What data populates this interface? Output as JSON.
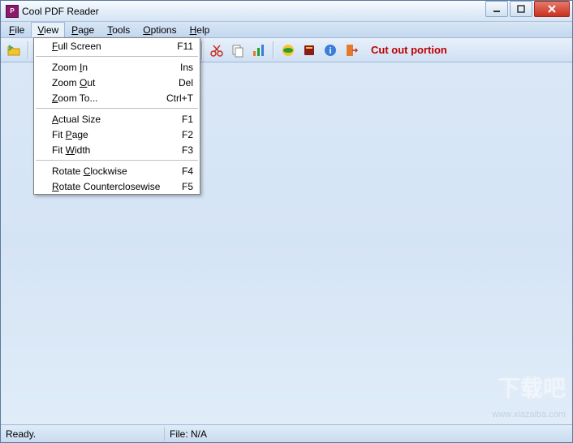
{
  "window": {
    "title": "Cool PDF Reader"
  },
  "menubar": {
    "file": "File",
    "view": "View",
    "page": "Page",
    "tools": "Tools",
    "options": "Options",
    "help": "Help"
  },
  "view_menu": {
    "full_screen": {
      "label": "F",
      "rest": "ull Screen",
      "shortcut": "F11"
    },
    "zoom_in": {
      "label": "Zoom ",
      "u": "I",
      "rest": "n",
      "shortcut": "Ins"
    },
    "zoom_out": {
      "label": "Zoom ",
      "u": "O",
      "rest": "ut",
      "shortcut": "Del"
    },
    "zoom_to": {
      "label": "Z",
      "rest": "oom To...",
      "shortcut": "Ctrl+T"
    },
    "actual_size": {
      "label": "A",
      "rest": "ctual Size",
      "shortcut": "F1"
    },
    "fit_page": {
      "label": "Fit ",
      "u": "P",
      "rest": "age",
      "shortcut": "F2"
    },
    "fit_width": {
      "label": "Fit ",
      "u": "W",
      "rest": "idth",
      "shortcut": "F3"
    },
    "rotate_cw": {
      "label": "Rotate ",
      "u": "C",
      "rest": "lockwise",
      "shortcut": "F4"
    },
    "rotate_ccw": {
      "label": "R",
      "rest": "otate Counterclosewise",
      "shortcut": "F5"
    }
  },
  "toolbar": {
    "hint": "Cut out portion"
  },
  "statusbar": {
    "ready": "Ready.",
    "file": "File: N/A"
  },
  "watermark": {
    "big": "下载吧",
    "url": "www.xiazaiba.com"
  }
}
